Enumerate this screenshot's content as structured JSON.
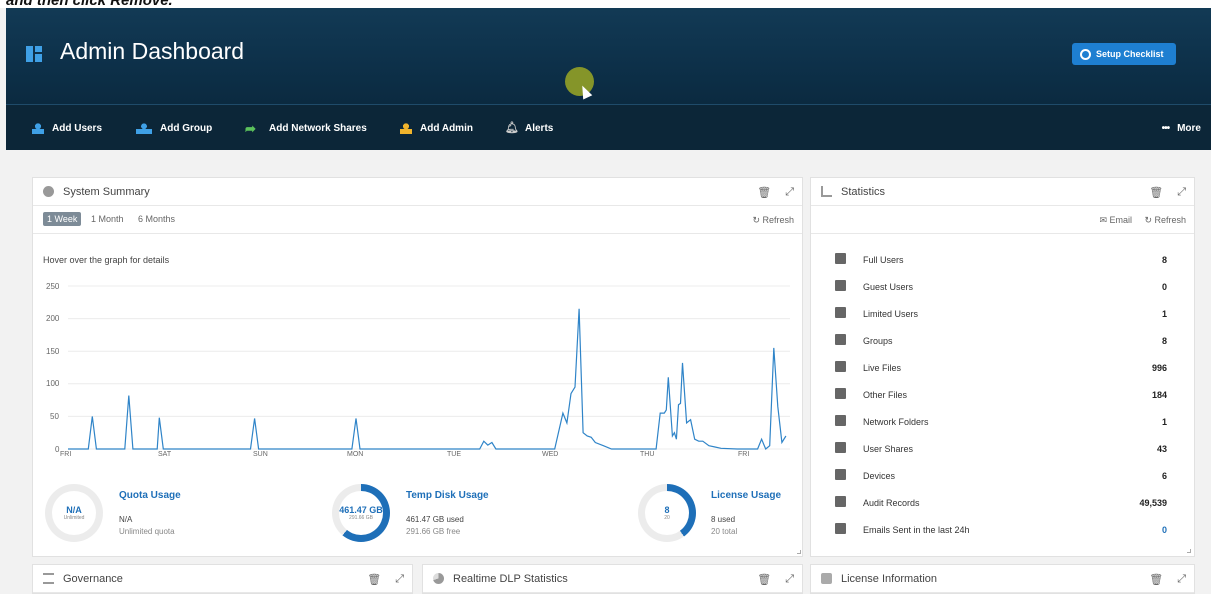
{
  "instruction_text": "and then click Remove.",
  "header": {
    "title": "Admin Dashboard",
    "setup_label": "Setup Checklist"
  },
  "nav": {
    "items": [
      {
        "label": "Add Users",
        "icon": "user-icon"
      },
      {
        "label": "Add Group",
        "icon": "group-icon"
      },
      {
        "label": "Add Network Shares",
        "icon": "share-arrow-icon"
      },
      {
        "label": "Add Admin",
        "icon": "admin-icon"
      },
      {
        "label": "Alerts",
        "icon": "bell-icon"
      }
    ],
    "more_label": "More"
  },
  "system_summary": {
    "title": "System Summary",
    "tabs": [
      "1 Week",
      "1 Month",
      "6 Months"
    ],
    "refresh_label": "Refresh",
    "hint": "Hover over the graph for details",
    "gauges": [
      {
        "center_value": "N/A",
        "center_sub": "Unlimited",
        "title": "Quota Usage",
        "line1": "N/A",
        "line2": "Unlimited quota",
        "fraction": 0
      },
      {
        "center_value": "461.47 GB",
        "center_sub": "291.66 GB",
        "title": "Temp Disk Usage",
        "line1": "461.47 GB used",
        "line2": "291.66 GB free",
        "fraction": 0.61
      },
      {
        "center_value": "8",
        "center_sub": "20",
        "title": "License Usage",
        "line1": "8 used",
        "line2": "20 total",
        "fraction": 0.4
      }
    ]
  },
  "chart_data": {
    "type": "line",
    "x_ticks": [
      "FRI",
      "SAT",
      "SUN",
      "MON",
      "TUE",
      "WED",
      "THU",
      "FRI"
    ],
    "ylim": [
      0,
      250
    ],
    "y_ticks": [
      0,
      50,
      100,
      150,
      200,
      250
    ],
    "grid": true,
    "color": "#2f84c8",
    "series": [
      {
        "points": [
          [
            0,
            0
          ],
          [
            0.1,
            0
          ],
          [
            0.12,
            50
          ],
          [
            0.14,
            0
          ],
          [
            0.28,
            0
          ],
          [
            0.3,
            82
          ],
          [
            0.32,
            0
          ],
          [
            0.44,
            0
          ],
          [
            0.45,
            48
          ],
          [
            0.47,
            0
          ],
          [
            0.9,
            0
          ],
          [
            0.92,
            47
          ],
          [
            0.94,
            0
          ],
          [
            1.4,
            0
          ],
          [
            1.42,
            47
          ],
          [
            1.44,
            0
          ],
          [
            2.0,
            0
          ],
          [
            2.03,
            0
          ],
          [
            2.05,
            12
          ],
          [
            2.07,
            6
          ],
          [
            2.09,
            10
          ],
          [
            2.11,
            0
          ],
          [
            2.4,
            0
          ],
          [
            2.44,
            55
          ],
          [
            2.46,
            40
          ],
          [
            2.48,
            85
          ],
          [
            2.5,
            95
          ],
          [
            2.52,
            215
          ],
          [
            2.54,
            25
          ],
          [
            2.56,
            20
          ],
          [
            2.58,
            18
          ],
          [
            2.6,
            10
          ],
          [
            2.64,
            5
          ],
          [
            2.68,
            0
          ],
          [
            2.9,
            0
          ],
          [
            2.92,
            55
          ],
          [
            2.94,
            55
          ],
          [
            2.95,
            60
          ],
          [
            2.96,
            110
          ],
          [
            2.98,
            20
          ],
          [
            2.99,
            25
          ],
          [
            3.0,
            15
          ],
          [
            3.01,
            68
          ],
          [
            3.02,
            70
          ],
          [
            3.03,
            132
          ],
          [
            3.05,
            40
          ],
          [
            3.07,
            45
          ],
          [
            3.09,
            15
          ],
          [
            3.11,
            12
          ],
          [
            3.13,
            12
          ],
          [
            3.16,
            5
          ],
          [
            3.19,
            3
          ],
          [
            3.22,
            1
          ],
          [
            3.3,
            0
          ],
          [
            3.4,
            0
          ],
          [
            3.42,
            15
          ],
          [
            3.44,
            0
          ],
          [
            3.46,
            5
          ],
          [
            3.48,
            155
          ],
          [
            3.5,
            65
          ],
          [
            3.52,
            10
          ],
          [
            3.54,
            20
          ]
        ]
      }
    ]
  },
  "statistics": {
    "title": "Statistics",
    "email_label": "Email",
    "refresh_label": "Refresh",
    "rows": [
      {
        "icon": "user-icon",
        "label": "Full Users",
        "value": "8"
      },
      {
        "icon": "guest-icon",
        "label": "Guest Users",
        "value": "0"
      },
      {
        "icon": "limited-user-icon",
        "label": "Limited Users",
        "value": "1"
      },
      {
        "icon": "group-icon",
        "label": "Groups",
        "value": "8"
      },
      {
        "icon": "file-icon",
        "label": "Live Files",
        "value": "996"
      },
      {
        "icon": "file-icon",
        "label": "Other Files",
        "value": "184"
      },
      {
        "icon": "folder-icon",
        "label": "Network Folders",
        "value": "1"
      },
      {
        "icon": "share-icon",
        "label": "User Shares",
        "value": "43"
      },
      {
        "icon": "laptop-icon",
        "label": "Devices",
        "value": "6"
      },
      {
        "icon": "user-icon",
        "label": "Audit Records",
        "value": "49,539"
      },
      {
        "icon": "envelope-icon",
        "label": "Emails Sent in the last 24h",
        "value": "0"
      }
    ]
  },
  "bottom_panels": [
    "Governance",
    "Realtime DLP Statistics",
    "License Information"
  ]
}
